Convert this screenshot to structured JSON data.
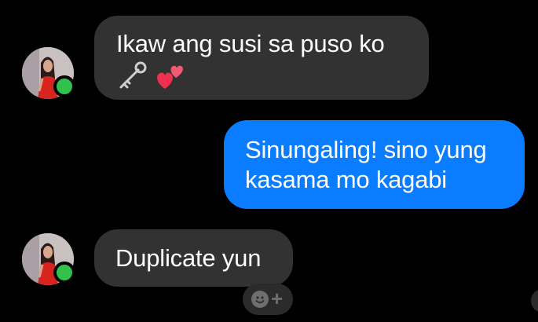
{
  "conversation": {
    "messages": [
      {
        "direction": "received",
        "text": "Ikaw ang susi sa puso ko",
        "emojis": [
          "old-key-icon",
          "two-hearts-icon"
        ],
        "sender_online": true
      },
      {
        "direction": "sent",
        "text_line1": "Sinungaling! sino yung",
        "text_line2": "kasama mo kagabi"
      },
      {
        "direction": "received",
        "text": "Duplicate yun",
        "sender_online": true
      }
    ],
    "reaction_button_plus": "+"
  },
  "colors": {
    "background": "#000000",
    "received_bubble": "#323232",
    "sent_bubble": "#0a7cff",
    "online_dot": "#31c24d",
    "text": "#ffffff"
  }
}
